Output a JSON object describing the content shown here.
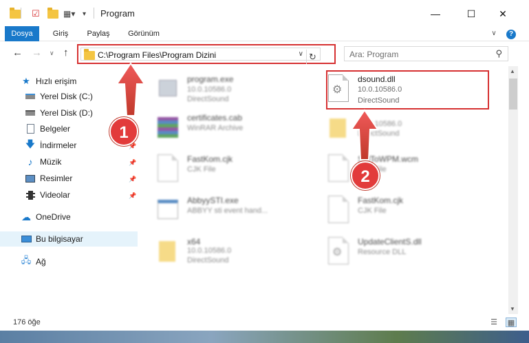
{
  "window": {
    "title": "Program"
  },
  "ribbon": {
    "tabs": [
      {
        "label": "Dosya"
      },
      {
        "label": "Giriş"
      },
      {
        "label": "Paylaş"
      },
      {
        "label": "Görünüm"
      }
    ]
  },
  "address": {
    "path": "C:\\Program Files\\Program Dizini",
    "search_placeholder": "Ara: Program"
  },
  "sidebar": {
    "items": [
      {
        "label": "Hızlı erişim",
        "icon": "star-icon"
      },
      {
        "label": "Yerel Disk (C:)",
        "icon": "drive-icon"
      },
      {
        "label": "Yerel Disk (D:)",
        "icon": "drive-icon"
      },
      {
        "label": "Belgeler",
        "icon": "documents-icon"
      },
      {
        "label": "İndirmeler",
        "icon": "download-icon"
      },
      {
        "label": "Müzik",
        "icon": "music-icon"
      },
      {
        "label": "Resimler",
        "icon": "pictures-icon"
      },
      {
        "label": "Videolar",
        "icon": "videos-icon"
      },
      {
        "label": "OneDrive",
        "icon": "cloud-icon"
      },
      {
        "label": "Bu bilgisayar",
        "icon": "computer-icon"
      },
      {
        "label": "Ağ",
        "icon": "network-icon"
      }
    ]
  },
  "files": [
    {
      "name": "program.exe",
      "line1": "10.0.10586.0",
      "line2": "DirectSound"
    },
    {
      "name": "dsound.dll",
      "line1": "10.0.10586.0",
      "line2": "DirectSound"
    },
    {
      "name": "certificates.cab",
      "line1": "WinRAR Archive",
      "line2": ""
    },
    {
      "name": "",
      "line1": "10.0.10586.0",
      "line2": "DirectSound"
    },
    {
      "name": "FastKom.cjk",
      "line1": "CJK File",
      "line2": ""
    },
    {
      "name": "StdToWPM.wcm",
      "line1": "CJK File",
      "line2": ""
    },
    {
      "name": "AbbyySTI.exe",
      "line1": "ABBYY sti event hand...",
      "line2": ""
    },
    {
      "name": "FastKom.cjk",
      "line1": "CJK File",
      "line2": ""
    },
    {
      "name": "x64",
      "line1": "10.0.10586.0",
      "line2": "DirectSound"
    },
    {
      "name": "UpdateClientS.dll",
      "line1": "Resource DLL",
      "line2": ""
    }
  ],
  "status": {
    "count": "176 öğe"
  },
  "annotations": {
    "step1": "1",
    "step2": "2"
  },
  "colors": {
    "accent": "#1979ca",
    "highlight": "#d63031",
    "badge": "#e23b3b"
  }
}
